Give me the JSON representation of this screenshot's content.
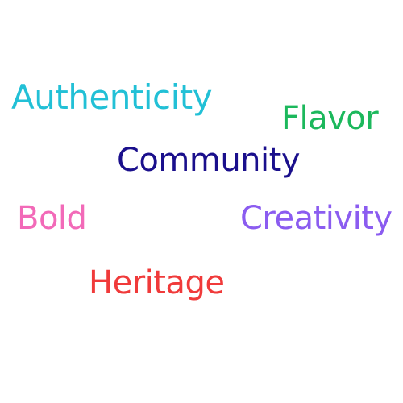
{
  "words": [
    {
      "text": "Authenticity",
      "color": "#22c0d6"
    },
    {
      "text": "Flavor",
      "color": "#1cb85c"
    },
    {
      "text": "Community",
      "color": "#1a0f8c"
    },
    {
      "text": "Bold",
      "color": "#f26ab8"
    },
    {
      "text": "Creativity",
      "color": "#8b5cf0"
    },
    {
      "text": "Heritage",
      "color": "#f03a3a"
    }
  ]
}
